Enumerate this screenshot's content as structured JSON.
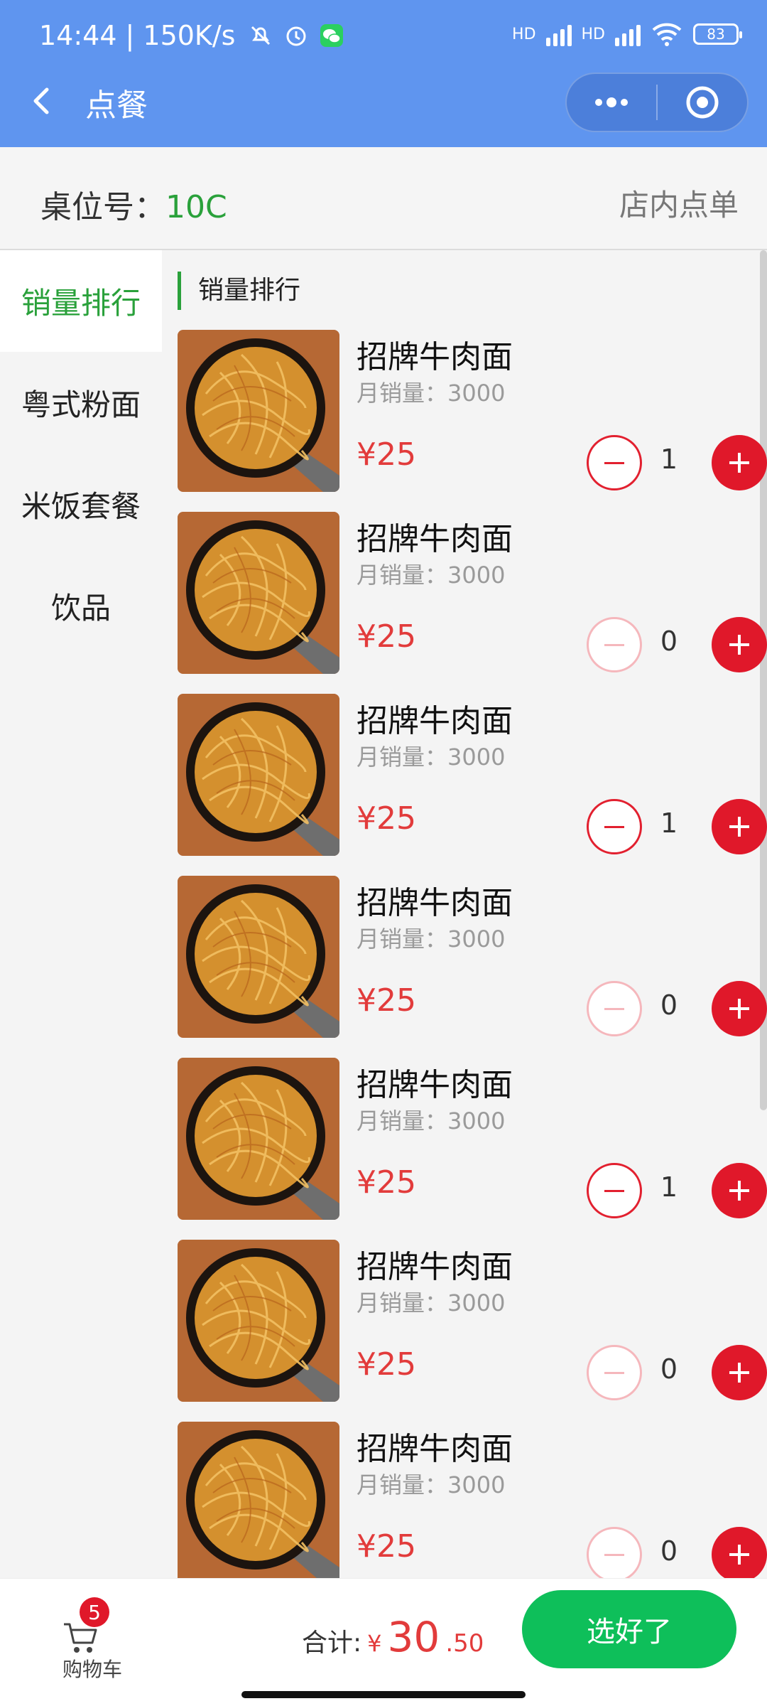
{
  "status": {
    "time": "14:44",
    "speed": "| 150K/s",
    "battery": "83",
    "hd1": "HD",
    "hd2": "HD"
  },
  "nav": {
    "title": "点餐"
  },
  "table": {
    "label": "桌位号：",
    "number": "10C",
    "mode": "店内点单"
  },
  "sidebar": {
    "items": [
      {
        "label": "销量排行"
      },
      {
        "label": "粤式粉面"
      },
      {
        "label": "米饭套餐"
      },
      {
        "label": "饮品"
      }
    ]
  },
  "content": {
    "section_title": "销量排行",
    "items": [
      {
        "name": "招牌牛肉面",
        "sales": "月销量：3000",
        "price": "¥25",
        "qty": "1"
      },
      {
        "name": "招牌牛肉面",
        "sales": "月销量：3000",
        "price": "¥25",
        "qty": "0"
      },
      {
        "name": "招牌牛肉面",
        "sales": "月销量：3000",
        "price": "¥25",
        "qty": "1"
      },
      {
        "name": "招牌牛肉面",
        "sales": "月销量：3000",
        "price": "¥25",
        "qty": "0"
      },
      {
        "name": "招牌牛肉面",
        "sales": "月销量：3000",
        "price": "¥25",
        "qty": "1"
      },
      {
        "name": "招牌牛肉面",
        "sales": "月销量：3000",
        "price": "¥25",
        "qty": "0"
      },
      {
        "name": "招牌牛肉面",
        "sales": "月销量：3000",
        "price": "¥25",
        "qty": "0"
      }
    ]
  },
  "bottom": {
    "cart_label": "购物车",
    "cart_badge": "5",
    "total_label": "合计:",
    "currency": "¥",
    "total_int": "30",
    "total_dec": ".50",
    "confirm": "选好了"
  },
  "colors": {
    "header": "#5f95ef",
    "accent_green": "#2aa13b",
    "red": "#e0182a",
    "confirm": "#0ebf5a"
  }
}
